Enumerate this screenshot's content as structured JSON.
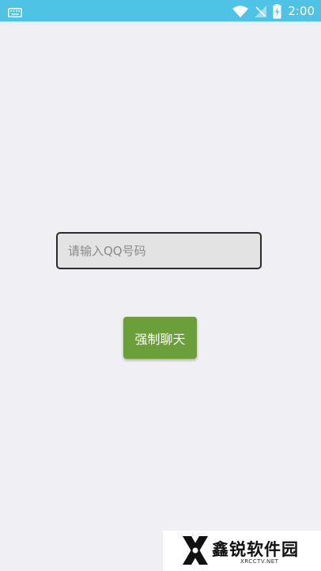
{
  "status_bar": {
    "time": "2:00",
    "icons": [
      "keyboard-icon",
      "wifi-icon",
      "no-signal-icon",
      "battery-charging-icon"
    ]
  },
  "main": {
    "qq_input": {
      "placeholder": "请输入QQ号码",
      "value": ""
    },
    "chat_button": {
      "label": "强制聊天"
    }
  },
  "watermark": {
    "title": "鑫锐软件园",
    "subtitle": "XRCCTV.NET"
  },
  "colors": {
    "status_bar": "#4fc3e6",
    "background": "#efeff4",
    "button": "#6a9f3a",
    "input_bg": "#e3e3e3"
  }
}
